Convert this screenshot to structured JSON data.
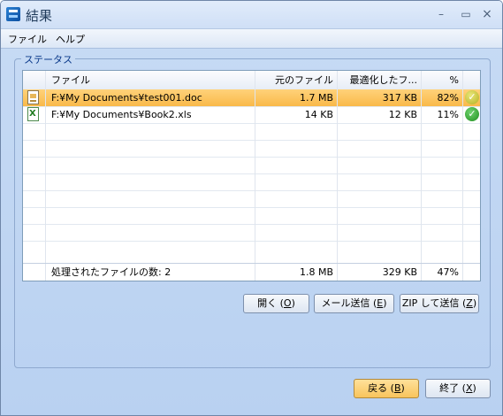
{
  "window": {
    "title": "結果"
  },
  "titlebar": {
    "minimize": "–",
    "maximize": "▭",
    "close": "×"
  },
  "menu": {
    "items": [
      "ファイル",
      "ヘルプ"
    ]
  },
  "group": {
    "label": "ステータス"
  },
  "table": {
    "headers": [
      "ファイル",
      "元のファイル",
      "最適化したフ...",
      "%"
    ],
    "rows": [
      {
        "icon": "word-doc-icon",
        "file": "F:¥My Documents¥test001.doc",
        "original": "1.7 MB",
        "optimized": "317 KB",
        "percent": "82%",
        "status": "check-icon"
      },
      {
        "icon": "excel-doc-icon",
        "file": "F:¥My Documents¥Book2.xls",
        "original": "14 KB",
        "optimized": "12 KB",
        "percent": "11%",
        "status": "check-icon"
      }
    ],
    "footer": {
      "label": "処理されたファイルの数: 2",
      "original": "1.8 MB",
      "optimized": "329 KB",
      "percent": "47%"
    }
  },
  "actions": {
    "open": {
      "label": "開く",
      "key": "O"
    },
    "mail": {
      "label": "メール送信",
      "key": "E"
    },
    "zip": {
      "label": "ZIP して送信",
      "key": "Z"
    }
  },
  "bottom": {
    "back": {
      "label": "戻る",
      "key": "B"
    },
    "exit": {
      "label": "終了",
      "key": "X"
    }
  },
  "colors": {
    "selected_row": "#f9b949",
    "accent": "#0b3a8a"
  }
}
